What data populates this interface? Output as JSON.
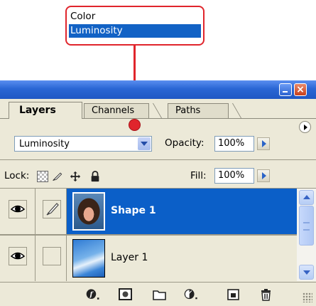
{
  "dropdown_callout": {
    "options": [
      "Color",
      "Luminosity"
    ],
    "selected": "Luminosity"
  },
  "palette": {
    "tabs": [
      {
        "label": "Layers",
        "active": true
      },
      {
        "label": "Channels",
        "active": false
      },
      {
        "label": "Paths",
        "active": false
      }
    ],
    "blend_mode": "Luminosity",
    "opacity_label": "Opacity:",
    "opacity_value": "100%",
    "lock_label": "Lock:",
    "fill_label": "Fill:",
    "fill_value": "100%",
    "layers": [
      {
        "name": "Shape 1",
        "selected": true,
        "visible": true
      },
      {
        "name": "Layer 1",
        "selected": false,
        "visible": true
      }
    ]
  },
  "colors": {
    "callout_red": "#e0252c",
    "selection_blue": "#0b5fc8",
    "titlebar_blue": "#2a66d4",
    "panel_bg": "#ece9d8"
  },
  "icons": {
    "window": [
      "minimize-icon",
      "close-icon"
    ],
    "palette_menu": "flyout-menu-icon",
    "lock": [
      "lock-transparency-icon",
      "lock-image-icon",
      "lock-position-icon",
      "lock-all-icon"
    ],
    "layer_row": [
      "eye-icon",
      "brush-icon"
    ],
    "toolbar": [
      "layer-style-icon",
      "layer-mask-icon",
      "new-group-icon",
      "adjustment-layer-icon",
      "new-layer-icon",
      "trash-icon"
    ]
  }
}
